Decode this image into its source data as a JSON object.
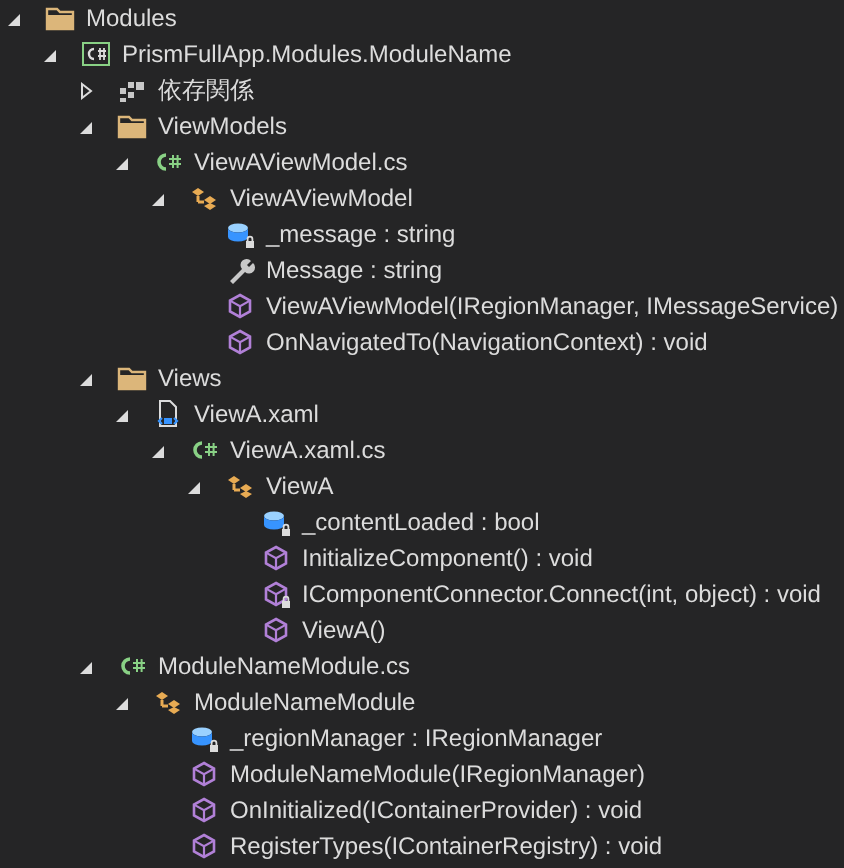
{
  "tree": [
    {
      "kind": "folder",
      "label": "Modules",
      "expanded": true,
      "children": [
        {
          "kind": "csproj",
          "label": "PrismFullApp.Modules.ModuleName",
          "expanded": true,
          "children": [
            {
              "kind": "dependencies",
              "label": "依存関係",
              "expanded": false
            },
            {
              "kind": "folder",
              "label": "ViewModels",
              "expanded": true,
              "children": [
                {
                  "kind": "csfile",
                  "label": "ViewAViewModel.cs",
                  "expanded": true,
                  "children": [
                    {
                      "kind": "class",
                      "label": "ViewAViewModel",
                      "expanded": true,
                      "children": [
                        {
                          "kind": "field",
                          "label": "_message : string",
                          "private": true
                        },
                        {
                          "kind": "property",
                          "label": "Message : string",
                          "private": false
                        },
                        {
                          "kind": "method",
                          "label": "ViewAViewModel(IRegionManager, IMessageService)",
                          "private": false
                        },
                        {
                          "kind": "method",
                          "label": "OnNavigatedTo(NavigationContext) : void",
                          "private": false
                        }
                      ]
                    }
                  ]
                }
              ]
            },
            {
              "kind": "folder",
              "label": "Views",
              "expanded": true,
              "children": [
                {
                  "kind": "xaml",
                  "label": "ViewA.xaml",
                  "expanded": true,
                  "children": [
                    {
                      "kind": "csfile",
                      "label": "ViewA.xaml.cs",
                      "expanded": true,
                      "children": [
                        {
                          "kind": "class",
                          "label": "ViewA",
                          "expanded": true,
                          "children": [
                            {
                              "kind": "field",
                              "label": "_contentLoaded : bool",
                              "private": true
                            },
                            {
                              "kind": "method",
                              "label": "InitializeComponent() : void",
                              "private": false
                            },
                            {
                              "kind": "method",
                              "label": "IComponentConnector.Connect(int, object) : void",
                              "private": true
                            },
                            {
                              "kind": "method",
                              "label": "ViewA()",
                              "private": false
                            }
                          ]
                        }
                      ]
                    }
                  ]
                }
              ]
            },
            {
              "kind": "csfile",
              "label": "ModuleNameModule.cs",
              "expanded": true,
              "children": [
                {
                  "kind": "class",
                  "label": "ModuleNameModule",
                  "expanded": true,
                  "children": [
                    {
                      "kind": "field",
                      "label": "_regionManager : IRegionManager",
                      "private": true
                    },
                    {
                      "kind": "method",
                      "label": "ModuleNameModule(IRegionManager)",
                      "private": false
                    },
                    {
                      "kind": "method",
                      "label": "OnInitialized(IContainerProvider) : void",
                      "private": false
                    },
                    {
                      "kind": "method",
                      "label": "RegisterTypes(IContainerRegistry) : void",
                      "private": false
                    }
                  ]
                }
              ]
            }
          ]
        }
      ]
    }
  ]
}
